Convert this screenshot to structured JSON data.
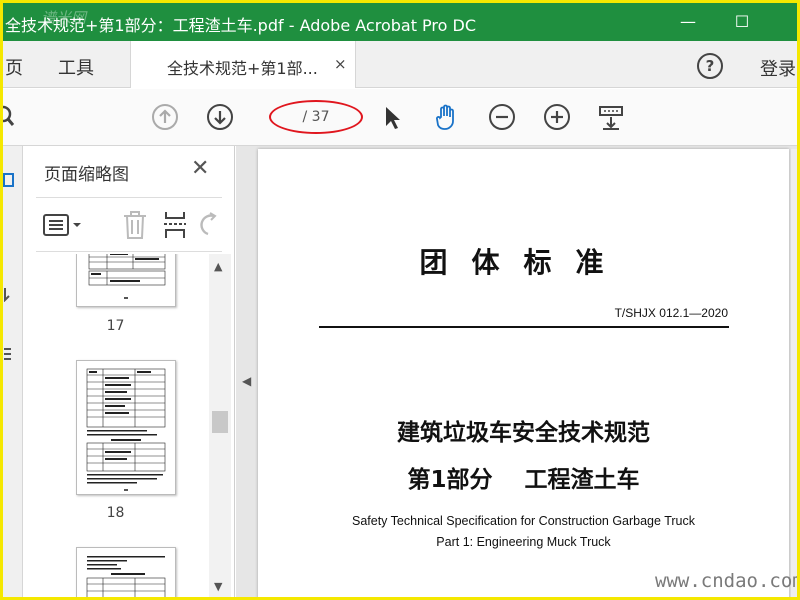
{
  "window": {
    "title": "全技术规范+第1部分：工程渣土车.pdf - Adobe Acrobat Pro DC",
    "minimize_label": "—",
    "maximize_label": "☐",
    "watermark": "谱米网"
  },
  "tabs": {
    "home_label": "页",
    "tools_label": "工具",
    "doc_tab_label": "全技术规范+第1部...",
    "doc_tab_close": "×",
    "help_label": "?",
    "login_label": "登录"
  },
  "toolbar": {
    "page_indicator": "/ 37",
    "icons": [
      "arrow-up-icon",
      "arrow-down-icon",
      "select-cursor-icon",
      "hand-tool-icon",
      "zoom-out-icon",
      "zoom-in-icon",
      "page-display-icon"
    ]
  },
  "thumbnails_panel": {
    "title": "页面缩略图",
    "close": "✕",
    "pages": [
      {
        "number": "17"
      },
      {
        "number": "18"
      },
      {
        "number": ""
      }
    ]
  },
  "document": {
    "standard_label": "团体标准",
    "code": "T/SHJX 012.1—2020",
    "title_cn": "建筑垃圾车安全技术规范",
    "subtitle_cn": "第1部分    工程渣土车",
    "title_en": "Safety Technical Specification for Construction Garbage Truck",
    "subtitle_en": "Part 1: Engineering Muck Truck"
  },
  "site_watermark": "www.cndao.com",
  "colors": {
    "title_bar": "#1f8f3f",
    "frame_border": "#f5e800",
    "annotation_oval": "#e0161e",
    "hand_tool_active": "#1a73c8"
  }
}
